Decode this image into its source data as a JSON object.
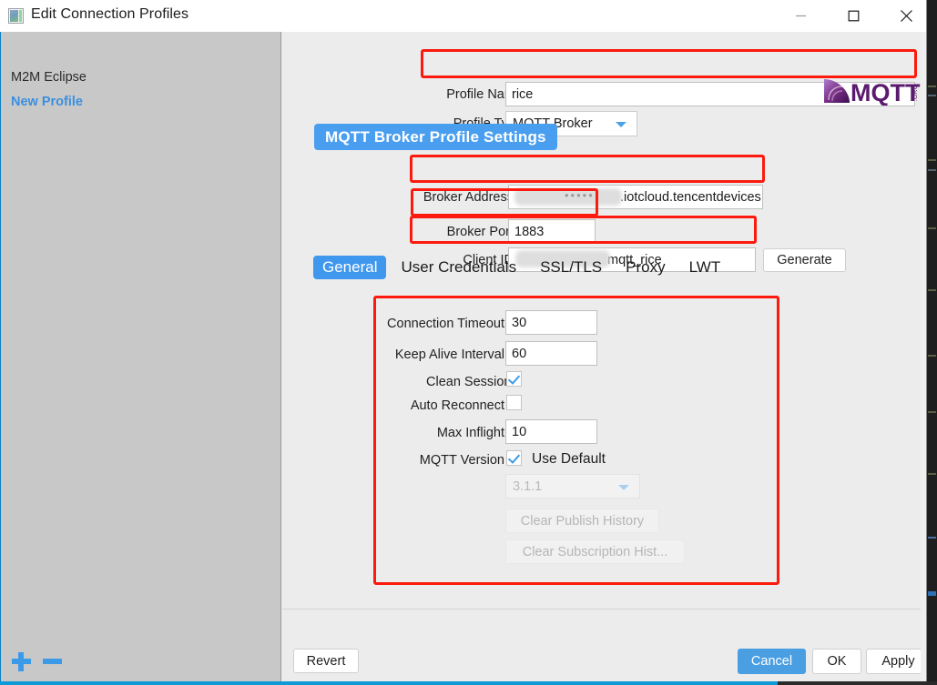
{
  "window": {
    "title": "Edit Connection Profiles",
    "icon": "app-icon",
    "minimize": "minimize-icon",
    "maximize": "maximize-icon",
    "close": "close-icon"
  },
  "sidebar": {
    "items": [
      {
        "label": "M2M Eclipse",
        "selected": false
      },
      {
        "label": "New Profile",
        "selected": true
      }
    ],
    "add_button": "+",
    "remove_button": "-"
  },
  "form": {
    "profile_name_label": "Profile Name",
    "profile_name_value": "rice",
    "profile_type_label": "Profile Type",
    "profile_type_value": "MQTT Broker",
    "logo_alt": "MQTT.org",
    "logo_text": "MQTT",
    "logo_sub": ".ORG"
  },
  "section": {
    "title": "MQTT Broker Profile Settings",
    "broker_address_label": "Broker Address",
    "broker_address_value": ".iotcloud.tencentdevices.c",
    "broker_port_label": "Broker Port",
    "broker_port_value": "1883",
    "client_id_label": "Client ID",
    "client_id_value": "mqtt_rice",
    "generate_label": "Generate"
  },
  "tabs": [
    {
      "label": "General",
      "active": true
    },
    {
      "label": "User Credentials",
      "active": false
    },
    {
      "label": "SSL/TLS",
      "active": false
    },
    {
      "label": "Proxy",
      "active": false
    },
    {
      "label": "LWT",
      "active": false
    }
  ],
  "general": {
    "connection_timeout_label": "Connection Timeout",
    "connection_timeout_value": "30",
    "keep_alive_label": "Keep Alive Interval",
    "keep_alive_value": "60",
    "clean_session_label": "Clean Session",
    "clean_session_checked": "true",
    "auto_reconnect_label": "Auto Reconnect",
    "auto_reconnect_checked": "false",
    "max_inflight_label": "Max Inflight",
    "max_inflight_value": "10",
    "mqtt_version_label": "MQTT Version",
    "use_default_label": "Use Default",
    "use_default_checked": "true",
    "version_value": "3.1.1",
    "clear_publish_label": "Clear Publish History",
    "clear_subscription_label": "Clear Subscription Hist..."
  },
  "footer": {
    "revert_label": "Revert",
    "cancel_label": "Cancel",
    "ok_label": "OK",
    "apply_label": "Apply"
  },
  "colors": {
    "accent_blue": "#4a9eef",
    "tab_active": "#3f97ee",
    "primary_button": "#4a9ee2",
    "annotation_red": "#fb1a0d",
    "link_blue": "#3b8fe0",
    "sidebar_bg": "#c8c8c8",
    "dialog_bg": "#ececec"
  }
}
